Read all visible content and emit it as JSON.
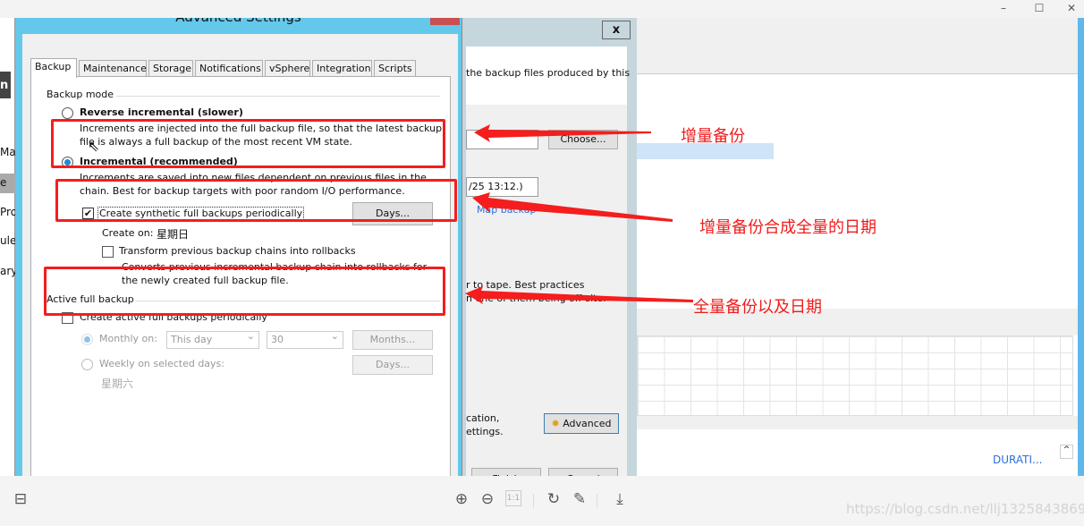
{
  "viewer": {
    "window_controls": [
      "–",
      "☐",
      "✕"
    ],
    "watermark": "https://blog.csdn.net/llj13258438698",
    "tools": [
      {
        "icon": "zoom-in-icon",
        "glyph": "⊕"
      },
      {
        "icon": "zoom-out-icon",
        "glyph": "⊖"
      },
      {
        "icon": "actual-size-icon",
        "glyph": "1:1"
      },
      {
        "icon": "rotate-icon",
        "glyph": "↻"
      },
      {
        "icon": "edit-icon",
        "glyph": "✎"
      },
      {
        "icon": "download-icon",
        "glyph": "⤓"
      }
    ],
    "thumbnail_icon": "⊟"
  },
  "background_app": {
    "sidebar_fragments": [
      "Ma",
      "e",
      "Pro",
      "ule",
      "ary"
    ],
    "logo_fragment": "n",
    "duration_header": "DURATI..."
  },
  "wizard": {
    "close_label": "x",
    "text_1": "the backup files produced by this",
    "choose_label": "Choose...",
    "restore_point": "/25 13:12.)",
    "link_fragment": "Map backup",
    "text_2": "r to tape. Best practices",
    "text_3": "n one of them being off-site.",
    "text_4": "cation,",
    "text_5": "ettings.",
    "advanced_label": "Advanced",
    "finish_label": "Finish",
    "cancel_label": "Cancel"
  },
  "dialog": {
    "title": "Advanced Settings",
    "tabs": [
      "Backup",
      "Maintenance",
      "Storage",
      "Notifications",
      "vSphere",
      "Integration",
      "Scripts"
    ],
    "backup_mode": {
      "label": "Backup mode",
      "reverse": {
        "label": "Reverse incremental (slower)",
        "desc1": "Increments are injected into the full backup file, so that the latest backup",
        "desc2": "file is always a full backup of the most recent VM state.",
        "selected": false
      },
      "incremental": {
        "label": "Incremental (recommended)",
        "desc1": "Increments are saved into new files dependent on previous files in the",
        "desc2": "chain. Best for backup targets with poor random I/O performance.",
        "selected": true
      },
      "synthetic": {
        "label": "Create synthetic full backups periodically",
        "checked": true,
        "days_label": "Days...",
        "create_on": "Create on:",
        "create_on_value": "星期日"
      },
      "transform": {
        "label": "Transform previous backup chains into rollbacks",
        "checked": false,
        "desc1": "Converts previous incremental backup chain into rollbacks for",
        "desc2": "the newly created full backup file."
      }
    },
    "active_full": {
      "label": "Active full backup",
      "create_label": "Create active full backups periodically",
      "checked": false,
      "monthly_label": "Monthly on:",
      "monthly_day": "This day",
      "monthly_num": "30",
      "months_label": "Months...",
      "weekly_label": "Weekly on selected days:",
      "weekly_days_label": "Days...",
      "weekly_value": "星期六"
    }
  },
  "annotations": [
    "增量备份",
    "增量备份合成全量的日期",
    "全量备份以及日期"
  ],
  "colors": {
    "annotation": "#f51d1d",
    "dialog_frame": "#64c8ea",
    "radio_selected": "#1e88d8"
  }
}
